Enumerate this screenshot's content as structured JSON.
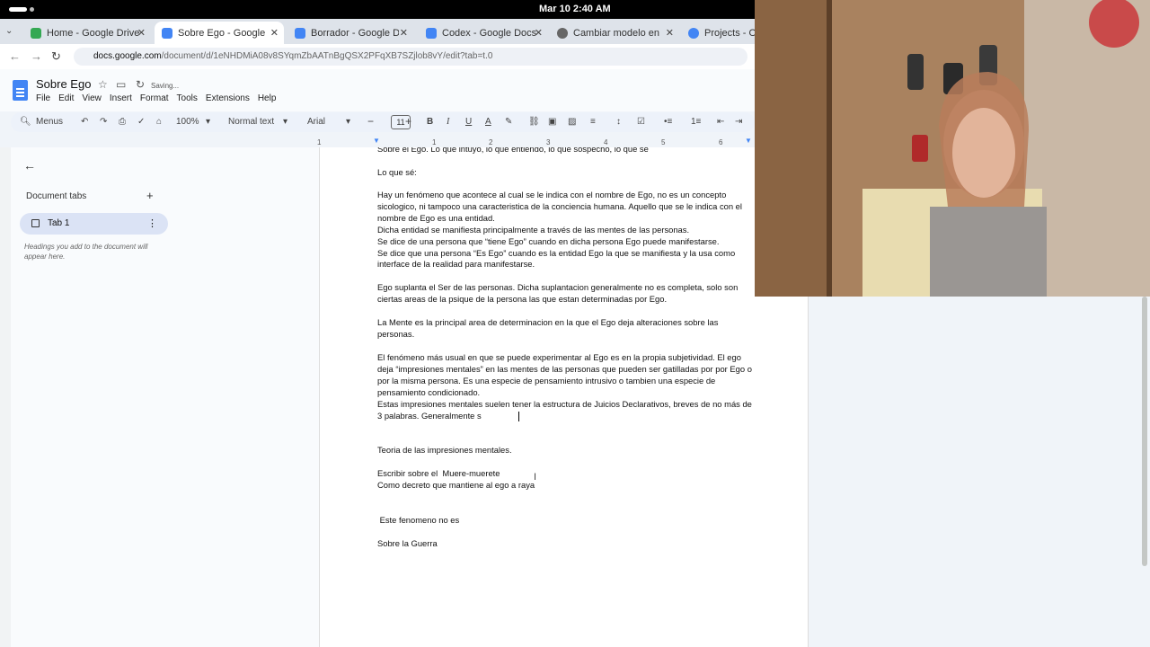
{
  "system": {
    "clock": "Mar 10  2:40 AM"
  },
  "browser": {
    "tabs": [
      {
        "title": "Home - Google Drive",
        "color": "#34a853"
      },
      {
        "title": "Sobre Ego - Google Docs",
        "color": "#4285f4"
      },
      {
        "title": "Borrador - Google Docs",
        "color": "#4285f4"
      },
      {
        "title": "Codex - Google Docs",
        "color": "#4285f4"
      },
      {
        "title": "Cambiar modelo en Codex",
        "color": "#666666"
      },
      {
        "title": "Projects - OpenAI",
        "color": "#4285f4"
      }
    ],
    "close_glyph": "✕",
    "url_domain": "docs.google.com",
    "url_path": "/document/d/1eNHDMiA08v8SYqmZbAATnBgQSX2PFqXB7SZjlob8vY/edit?tab=t.0"
  },
  "docs": {
    "title": "Sobre Ego",
    "status": "Saving...",
    "menu": [
      "File",
      "Edit",
      "View",
      "Insert",
      "Format",
      "Tools",
      "Extensions",
      "Help"
    ],
    "toolbar": {
      "search": "Menus",
      "zoom": "100%",
      "style": "Normal text",
      "font": "Arial",
      "size": "11"
    },
    "ruler_marks": [
      "1",
      "1",
      "2",
      "3",
      "4",
      "5",
      "6"
    ]
  },
  "sidebar": {
    "heading": "Document tabs",
    "tab_label": "Tab 1",
    "hint": "Headings you add to the document will appear here."
  },
  "document": {
    "p1": "Sobre el Ego. Lo que intuyo, lo que entiendo, lo que sospecho, lo que sé",
    "p2": "Lo que sé:",
    "p3": "Hay un fenómeno que acontece al cual se le indica con el nombre de Ego, no es un concepto sicologico, ni tampoco una caracteristica de la conciencia humana. Aquello que se le indica con el nombre de Ego es una entidad.\nDicha entidad se manifiesta principalmente a través de las mentes de las personas.\nSe dice de una persona que “tiene Ego” cuando en dicha persona Ego puede manifestarse.\nSe dice que una persona “Es Ego” cuando es la entidad Ego la que se manifiesta y la usa como interface de la realidad para manifestarse.",
    "p4": "Ego suplanta el Ser de las personas. Dicha suplantacion generalmente no es completa, solo son ciertas areas de la psique de la persona las que estan determinadas por Ego.",
    "p5": "La Mente es la principal area de determinacion en la que el Ego deja alteraciones sobre las personas.",
    "p6": "El fenómeno más usual en que se puede experimentar al Ego es en la propia subjetividad. El ego deja “impresiones mentales” en las mentes de las personas que pueden ser gatilladas por por Ego o por la misma persona. Es una especie de pensamiento intrusivo o tambien una especie de pensamiento condicionado.\nEstas impresiones mentales suelen tener la estructura de Juicios Declarativos, breves de no más de 3 palabras. Generalmente s",
    "p7": "Teoria de las impresiones mentales.",
    "p8": "Escribir sobre el  Muere-muerete\nComo decreto que mantiene al ego a raya",
    "p9": " Este fenomeno no es",
    "p10": "Sobre la Guerra"
  }
}
